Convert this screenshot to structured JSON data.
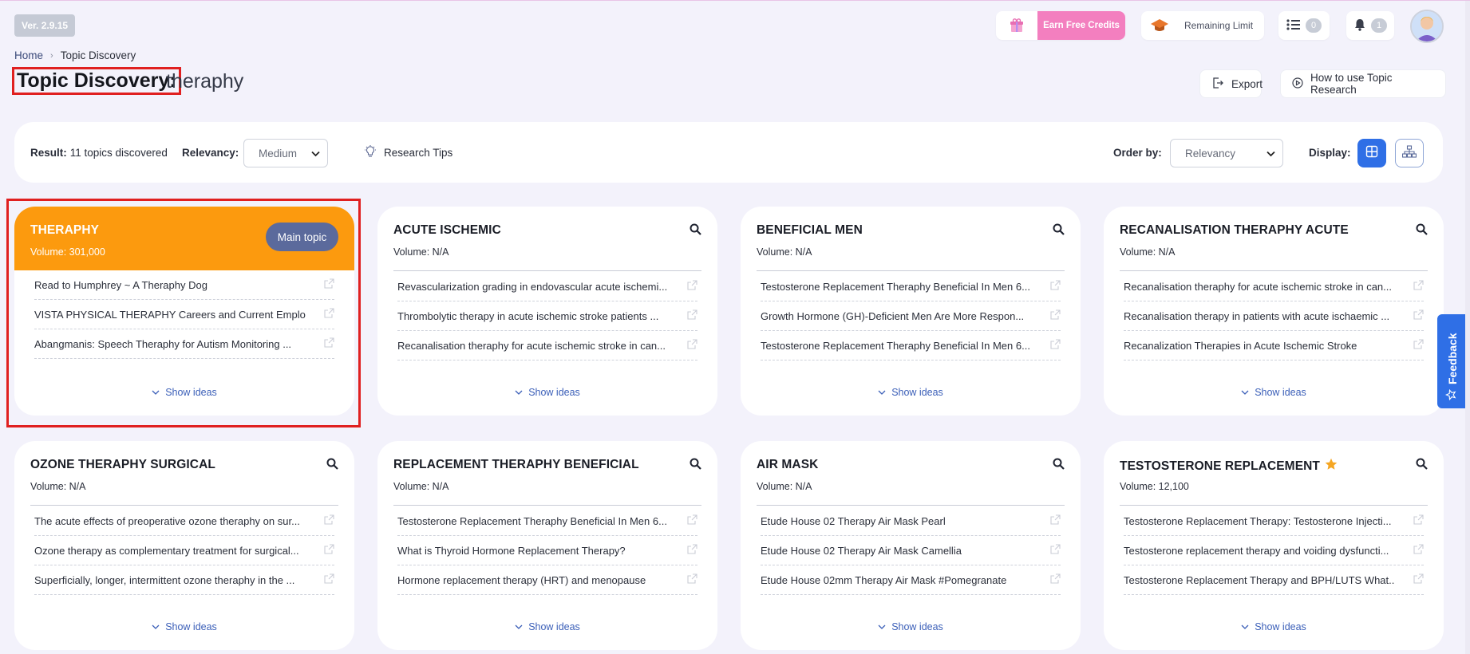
{
  "header": {
    "version": "Ver. 2.9.15",
    "earn_credits": "Earn Free Credits",
    "remaining_limit": "Remaining Limit",
    "list_count": "0",
    "notification_count": "1"
  },
  "breadcrumb": {
    "home": "Home",
    "current": "Topic Discovery"
  },
  "page": {
    "title": "Topic Discovery:",
    "query": "theraphy",
    "export_label": "Export",
    "howto_label": "How to use Topic Research"
  },
  "filters": {
    "result_label": "Result:",
    "result_value": "11 topics discovered",
    "relevancy_label": "Relevancy:",
    "relevancy_value": "Medium",
    "tips_label": "Research Tips",
    "order_label": "Order by:",
    "order_value": "Relevancy",
    "display_label": "Display:"
  },
  "cards": [
    {
      "title": "THERAPHY",
      "volume": "Volume: 301,000",
      "badge": "Main topic",
      "ideas": [
        "Read to Humphrey ~ A Theraphy Dog",
        "VISTA PHYSICAL THERAPHY Careers and Current Emplo...",
        "Abangmanis: Speech Theraphy for Autism Monitoring ..."
      ],
      "show": "Show ideas"
    },
    {
      "title": "ACUTE ISCHEMIC",
      "volume": "Volume: N/A",
      "ideas": [
        "Revascularization grading in endovascular acute ischemi...",
        "Thrombolytic therapy in acute ischemic stroke patients ...",
        "Recanalisation theraphy for acute ischemic stroke in can..."
      ],
      "show": "Show ideas"
    },
    {
      "title": "BENEFICIAL MEN",
      "volume": "Volume: N/A",
      "ideas": [
        "Testosterone Replacement Theraphy Beneficial In Men 6...",
        "Growth Hormone (GH)-Deficient Men Are More Respon...",
        "Testosterone Replacement Theraphy Beneficial In Men 6..."
      ],
      "show": "Show ideas"
    },
    {
      "title": "RECANALISATION THERAPHY ACUTE",
      "volume": "Volume: N/A",
      "ideas": [
        "Recanalisation theraphy for acute ischemic stroke in can...",
        "Recanalisation therapy in patients with acute ischaemic ...",
        "Recanalization Therapies in Acute Ischemic Stroke"
      ],
      "show": "Show ideas"
    },
    {
      "title": "OZONE THERAPHY SURGICAL",
      "volume": "Volume: N/A",
      "ideas": [
        "The acute effects of preoperative ozone theraphy on sur...",
        "Ozone therapy as complementary treatment for surgical...",
        "Superficially, longer, intermittent ozone theraphy in the ..."
      ],
      "show": "Show ideas"
    },
    {
      "title": "REPLACEMENT THERAPHY BENEFICIAL",
      "volume": "Volume: N/A",
      "ideas": [
        "Testosterone Replacement Theraphy Beneficial In Men 6...",
        "What is Thyroid Hormone Replacement Therapy?",
        "Hormone replacement therapy (HRT) and menopause"
      ],
      "show": "Show ideas"
    },
    {
      "title": "AIR MASK",
      "volume": "Volume: N/A",
      "ideas": [
        "Etude House 02 Therapy Air Mask Pearl",
        "Etude House 02 Therapy Air Mask Camellia",
        "Etude House 02mm Therapy Air Mask #Pomegranate"
      ],
      "show": "Show ideas"
    },
    {
      "title": "TESTOSTERONE REPLACEMENT",
      "volume": "Volume: 12,100",
      "ideas": [
        "Testosterone Replacement Therapy: Testosterone Injecti...",
        "Testosterone replacement therapy and voiding dysfuncti...",
        "Testosterone Replacement Therapy and BPH/LUTS What..."
      ],
      "show": "Show ideas"
    }
  ],
  "feedback_label": "Feedback",
  "colors": {
    "main_topic": "#fc9a0e",
    "accent": "#2f6fe6",
    "earn_credits": "#f37fbf",
    "highlight_box": "#e02020"
  }
}
